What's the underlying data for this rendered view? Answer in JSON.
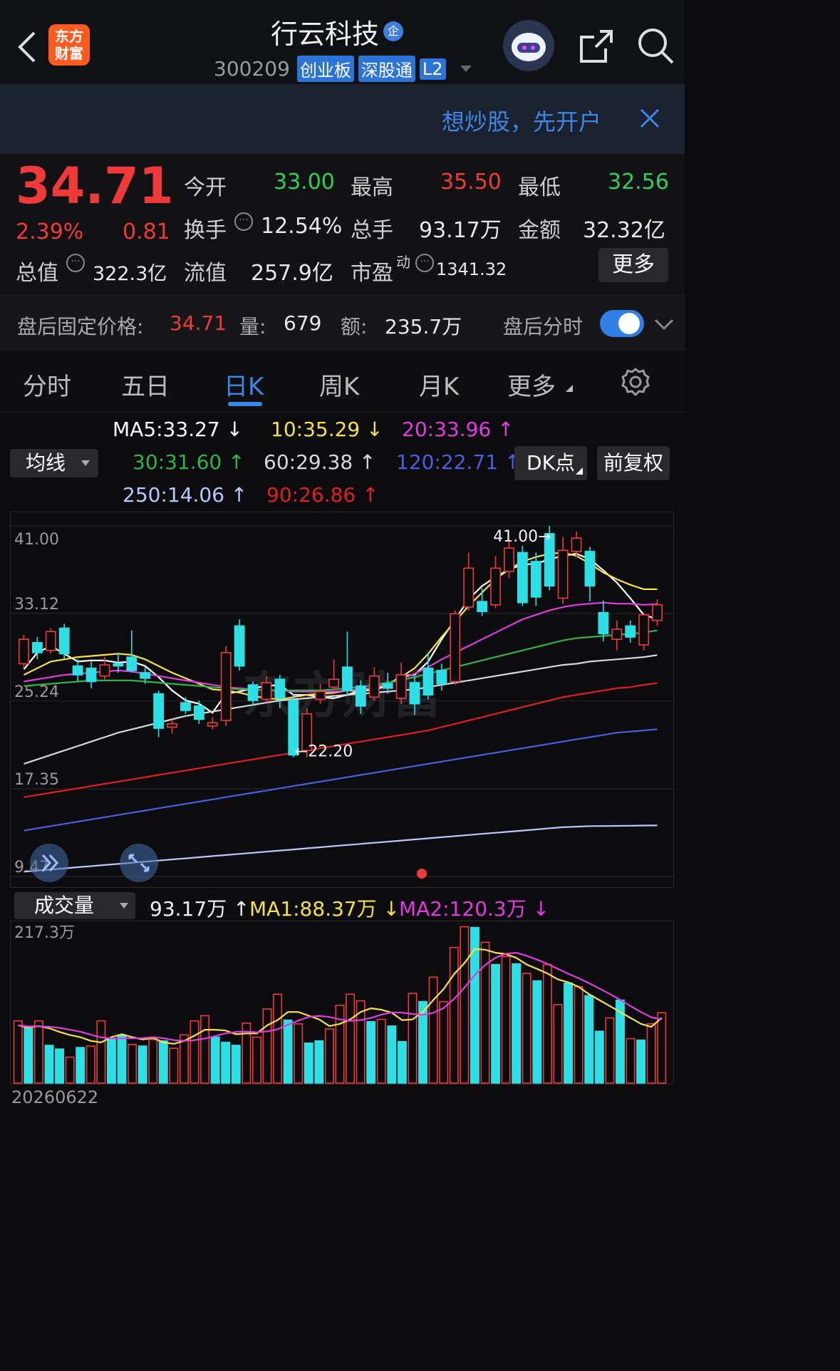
{
  "header": {
    "stock_name": "行云科技",
    "badge": "企",
    "code": "300209",
    "tags": [
      "创业板",
      "深股通",
      "L2"
    ],
    "logo_text": "东方财富"
  },
  "banner": {
    "text": "想炒股，先开户"
  },
  "quote": {
    "price": "34.71",
    "change_pct": "2.39%",
    "change": "0.81",
    "fields": [
      {
        "label": "今开",
        "value": "33.00",
        "color": "#2fd05a"
      },
      {
        "label": "最高",
        "value": "35.50",
        "color": "#f03a3a"
      },
      {
        "label": "最低",
        "value": "32.56",
        "color": "#2fd05a"
      },
      {
        "label": "换手",
        "value": "12.54%",
        "color": "#e8e8e8"
      },
      {
        "label": "总手",
        "value": "93.17万",
        "color": "#e8e8e8"
      },
      {
        "label": "金额",
        "value": "32.32亿",
        "color": "#e8e8e8"
      },
      {
        "label": "总值",
        "value": "322.3亿",
        "color": "#e8e8e8"
      },
      {
        "label": "流值",
        "value": "257.9亿",
        "color": "#e8e8e8"
      },
      {
        "label": "市盈",
        "sup": "动",
        "value": "1341.32",
        "color": "#e8e8e8"
      }
    ],
    "more_button": "更多"
  },
  "after_hours": {
    "label": "盘后固定价格:",
    "price": "34.71",
    "vol_label": "量:",
    "vol": "679",
    "amt_label": "额:",
    "amt": "235.7万",
    "toggle_label": "盘后分时",
    "toggle_on": true
  },
  "tabs": [
    "分时",
    "五日",
    "日K",
    "周K",
    "月K",
    "更多"
  ],
  "active_tab": "日K",
  "ma_legend": [
    {
      "text": "MA5:33.27 ↓",
      "color": "#ffffff"
    },
    {
      "text": "10:35.29 ↓",
      "color": "#f5e24a"
    },
    {
      "text": "20:33.96 ↑",
      "color": "#e03ce0"
    },
    {
      "text": "30:31.60 ↑",
      "color": "#2fb34a"
    },
    {
      "text": "60:29.38 ↑",
      "color": "#d8d8d8"
    },
    {
      "text": "120:22.71 ↑",
      "color": "#4a5ee0"
    },
    {
      "text": "250:14.06 ↑",
      "color": "#b9c7ff"
    },
    {
      "text": "90:26.86 ↑",
      "color": "#e02020"
    }
  ],
  "controls": {
    "ma_select": "均线",
    "dk_button": "DK点",
    "fq_button": "前复权"
  },
  "volume_legend": {
    "select": "成交量",
    "vol": "93.17万 ↑",
    "ma1": "MA1:88.37万 ↓",
    "ma2": "MA2:120.3万 ↓",
    "ma1_color": "#f5e24a",
    "ma2_color": "#e03ce0"
  },
  "colors": {
    "up": "#f03a3a",
    "down": "#2ce0e6",
    "accent": "#3e86e6"
  },
  "watermark": "东方财富",
  "chart_data": {
    "type": "candlestick",
    "date_label": "20260622",
    "y_ticks": [
      "41.00",
      "33.12",
      "25.24",
      "17.35",
      "9.47"
    ],
    "ylim": [
      9.47,
      41.0
    ],
    "annotations": [
      {
        "text": "41.00",
        "value": 41.0,
        "index": 40
      },
      {
        "text": "22.20",
        "value": 22.2,
        "index": 20
      }
    ],
    "candles": [
      {
        "o": 28.6,
        "c": 30.8,
        "h": 31.2,
        "l": 28.2
      },
      {
        "o": 30.5,
        "c": 29.6,
        "h": 31.0,
        "l": 29.0
      },
      {
        "o": 29.8,
        "c": 31.5,
        "h": 31.8,
        "l": 29.5
      },
      {
        "o": 31.8,
        "c": 29.5,
        "h": 32.2,
        "l": 29.0
      },
      {
        "o": 28.4,
        "c": 27.6,
        "h": 29.0,
        "l": 27.0
      },
      {
        "o": 28.2,
        "c": 27.0,
        "h": 28.8,
        "l": 26.4
      },
      {
        "o": 27.5,
        "c": 28.5,
        "h": 29.2,
        "l": 27.2
      },
      {
        "o": 28.6,
        "c": 28.4,
        "h": 29.6,
        "l": 27.8
      },
      {
        "o": 29.2,
        "c": 28.0,
        "h": 31.6,
        "l": 27.8
      },
      {
        "o": 27.8,
        "c": 27.3,
        "h": 28.3,
        "l": 26.8
      },
      {
        "o": 25.9,
        "c": 22.8,
        "h": 26.2,
        "l": 22.0
      },
      {
        "o": 22.9,
        "c": 23.2,
        "h": 23.6,
        "l": 22.3
      },
      {
        "o": 25.1,
        "c": 24.4,
        "h": 25.6,
        "l": 24.1
      },
      {
        "o": 24.8,
        "c": 23.6,
        "h": 25.3,
        "l": 23.2
      },
      {
        "o": 23.0,
        "c": 23.3,
        "h": 23.8,
        "l": 22.7
      },
      {
        "o": 23.5,
        "c": 29.6,
        "h": 30.2,
        "l": 23.0
      },
      {
        "o": 32.0,
        "c": 28.4,
        "h": 32.6,
        "l": 28.0
      },
      {
        "o": 26.7,
        "c": 25.3,
        "h": 27.0,
        "l": 24.8
      },
      {
        "o": 25.4,
        "c": 26.9,
        "h": 27.5,
        "l": 25.1
      },
      {
        "o": 27.2,
        "c": 25.5,
        "h": 27.6,
        "l": 24.6
      },
      {
        "o": 25.3,
        "c": 20.4,
        "h": 25.8,
        "l": 20.2
      },
      {
        "o": 20.8,
        "c": 24.1,
        "h": 24.6,
        "l": 20.2
      },
      {
        "o": 25.4,
        "c": 26.1,
        "h": 26.8,
        "l": 25.0
      },
      {
        "o": 26.5,
        "c": 27.2,
        "h": 29.0,
        "l": 26.2
      },
      {
        "o": 28.3,
        "c": 26.2,
        "h": 31.5,
        "l": 25.8
      },
      {
        "o": 26.6,
        "c": 24.8,
        "h": 27.1,
        "l": 24.1
      },
      {
        "o": 25.6,
        "c": 27.5,
        "h": 28.3,
        "l": 25.3
      },
      {
        "o": 26.8,
        "c": 26.4,
        "h": 27.8,
        "l": 25.9
      },
      {
        "o": 25.5,
        "c": 27.6,
        "h": 28.7,
        "l": 25.0
      },
      {
        "o": 26.9,
        "c": 25.0,
        "h": 27.4,
        "l": 24.0
      },
      {
        "o": 28.2,
        "c": 25.8,
        "h": 29.6,
        "l": 25.4
      },
      {
        "o": 28.0,
        "c": 26.8,
        "h": 28.6,
        "l": 26.2
      },
      {
        "o": 27.0,
        "c": 33.1,
        "h": 33.4,
        "l": 26.7
      },
      {
        "o": 33.7,
        "c": 37.2,
        "h": 38.6,
        "l": 33.4
      },
      {
        "o": 34.2,
        "c": 33.3,
        "h": 35.4,
        "l": 32.9
      },
      {
        "o": 33.9,
        "c": 37.2,
        "h": 38.3,
        "l": 33.6
      },
      {
        "o": 36.9,
        "c": 39.0,
        "h": 39.6,
        "l": 36.3
      },
      {
        "o": 38.6,
        "c": 34.1,
        "h": 39.2,
        "l": 33.8
      },
      {
        "o": 37.8,
        "c": 34.6,
        "h": 38.6,
        "l": 33.8
      },
      {
        "o": 40.3,
        "c": 35.6,
        "h": 41.0,
        "l": 35.2
      },
      {
        "o": 34.5,
        "c": 38.8,
        "h": 40.0,
        "l": 34.0
      },
      {
        "o": 38.7,
        "c": 39.9,
        "h": 40.5,
        "l": 38.2
      },
      {
        "o": 38.7,
        "c": 35.6,
        "h": 39.1,
        "l": 34.2
      },
      {
        "o": 33.2,
        "c": 31.3,
        "h": 34.3,
        "l": 30.6
      },
      {
        "o": 30.8,
        "c": 31.7,
        "h": 32.5,
        "l": 29.8
      },
      {
        "o": 32.0,
        "c": 31.0,
        "h": 32.5,
        "l": 30.5
      },
      {
        "o": 30.3,
        "c": 33.0,
        "h": 33.2,
        "l": 29.8
      },
      {
        "o": 32.5,
        "c": 33.9,
        "h": 34.4,
        "l": 32.0
      }
    ],
    "ma_lines": [
      {
        "name": "MA5",
        "color": "#ffffff",
        "values": [
          28.1,
          29.6,
          30.2,
          29.5,
          28.8,
          28.9,
          28.9,
          28.7,
          28.8,
          28.4,
          27.4,
          26.2,
          25.3,
          25.0,
          24.2,
          25.9,
          26.1,
          26.4,
          26.6,
          26.7,
          25.8,
          25.8,
          25.6,
          25.5,
          25.8,
          26.2,
          26.2,
          26.7,
          27.5,
          27.6,
          28.8,
          30.8,
          32.6,
          34.4,
          35.6,
          36.4,
          37.1,
          37.5,
          37.6,
          38.0,
          38.3,
          38.5,
          38.0,
          37.0,
          35.9,
          34.5,
          33.0,
          32.6
        ]
      },
      {
        "name": "MA10",
        "color": "#f5e24a",
        "values": [
          27.6,
          28.2,
          28.8,
          29.0,
          29.2,
          29.3,
          29.4,
          29.5,
          29.4,
          29.0,
          28.4,
          27.8,
          27.3,
          26.8,
          26.3,
          26.2,
          26.0,
          25.7,
          25.5,
          25.4,
          25.6,
          25.8,
          25.9,
          26.0,
          26.2,
          26.1,
          26.4,
          26.8,
          27.4,
          28.2,
          29.5,
          31.0,
          32.4,
          33.8,
          35.0,
          36.2,
          37.1,
          37.8,
          38.2,
          38.5,
          38.6,
          38.3,
          37.6,
          36.8,
          36.2,
          35.7,
          35.3,
          35.3
        ]
      },
      {
        "name": "MA20",
        "color": "#e03ce0",
        "values": [
          27.0,
          27.2,
          27.4,
          27.6,
          27.7,
          27.8,
          27.9,
          28.0,
          27.9,
          27.7,
          27.5,
          27.3,
          27.1,
          26.9,
          26.7,
          26.5,
          26.4,
          26.3,
          26.2,
          26.2,
          26.1,
          26.1,
          26.1,
          26.1,
          26.2,
          26.3,
          26.5,
          26.8,
          27.2,
          27.7,
          28.3,
          29.0,
          29.6,
          30.2,
          30.8,
          31.4,
          32.0,
          32.6,
          33.0,
          33.4,
          33.7,
          33.9,
          34.0,
          34.1,
          34.0,
          34.0,
          33.9,
          33.96
        ]
      },
      {
        "name": "MA30",
        "color": "#2fb34a",
        "values": [
          26.6,
          26.7,
          26.8,
          26.9,
          27.0,
          27.1,
          27.1,
          27.1,
          27.1,
          27.0,
          26.9,
          26.8,
          26.7,
          26.6,
          26.5,
          26.4,
          26.3,
          26.3,
          26.2,
          26.2,
          26.2,
          26.2,
          26.2,
          26.3,
          26.4,
          26.5,
          26.7,
          26.9,
          27.1,
          27.4,
          27.7,
          28.0,
          28.3,
          28.6,
          28.9,
          29.2,
          29.5,
          29.8,
          30.1,
          30.4,
          30.7,
          30.9,
          31.0,
          31.1,
          31.2,
          31.3,
          31.4,
          31.6
        ]
      },
      {
        "name": "MA60",
        "color": "#d8d8d8",
        "values": [
          19.6,
          20.0,
          20.4,
          20.8,
          21.2,
          21.6,
          22.0,
          22.4,
          22.7,
          23.0,
          23.3,
          23.6,
          23.9,
          24.1,
          24.3,
          24.5,
          24.7,
          24.9,
          25.1,
          25.3,
          25.4,
          25.5,
          25.6,
          25.7,
          25.8,
          25.9,
          26.0,
          26.1,
          26.2,
          26.3,
          26.5,
          26.7,
          26.9,
          27.1,
          27.3,
          27.5,
          27.7,
          27.9,
          28.1,
          28.3,
          28.5,
          28.6,
          28.8,
          28.9,
          29.0,
          29.1,
          29.2,
          29.38
        ]
      },
      {
        "name": "MA90",
        "color": "#e02020",
        "values": [
          16.6,
          16.8,
          17.0,
          17.2,
          17.4,
          17.6,
          17.8,
          18.0,
          18.2,
          18.4,
          18.6,
          18.8,
          19.0,
          19.2,
          19.4,
          19.6,
          19.8,
          20.0,
          20.2,
          20.4,
          20.6,
          20.8,
          21.0,
          21.2,
          21.4,
          21.6,
          21.8,
          22.0,
          22.2,
          22.4,
          22.6,
          22.9,
          23.2,
          23.5,
          23.8,
          24.1,
          24.4,
          24.7,
          25.0,
          25.3,
          25.6,
          25.8,
          26.0,
          26.2,
          26.4,
          26.5,
          26.7,
          26.86
        ]
      },
      {
        "name": "MA120",
        "color": "#4a5ee0",
        "values": [
          13.6,
          13.8,
          14.0,
          14.2,
          14.4,
          14.6,
          14.8,
          15.0,
          15.2,
          15.4,
          15.6,
          15.8,
          16.0,
          16.2,
          16.4,
          16.6,
          16.8,
          17.0,
          17.2,
          17.4,
          17.6,
          17.8,
          18.0,
          18.2,
          18.4,
          18.6,
          18.8,
          19.0,
          19.2,
          19.4,
          19.6,
          19.8,
          20.0,
          20.2,
          20.4,
          20.6,
          20.8,
          21.0,
          21.2,
          21.4,
          21.6,
          21.8,
          22.0,
          22.2,
          22.4,
          22.5,
          22.6,
          22.71
        ]
      },
      {
        "name": "MA250",
        "color": "#b9c7ff",
        "values": [
          9.9,
          10.0,
          10.1,
          10.2,
          10.3,
          10.4,
          10.5,
          10.6,
          10.7,
          10.8,
          10.9,
          11.0,
          11.1,
          11.2,
          11.3,
          11.4,
          11.5,
          11.6,
          11.7,
          11.8,
          11.9,
          12.0,
          12.1,
          12.2,
          12.3,
          12.4,
          12.5,
          12.6,
          12.7,
          12.8,
          12.9,
          13.0,
          13.1,
          13.2,
          13.3,
          13.4,
          13.5,
          13.6,
          13.7,
          13.8,
          13.9,
          13.95,
          14.0,
          14.01,
          14.02,
          14.03,
          14.05,
          14.06
        ]
      }
    ],
    "volume": {
      "max_label": "217.3万",
      "ymax": 217.3,
      "bars": [
        84,
        76,
        84,
        51,
        46,
        35,
        48,
        50,
        84,
        60,
        65,
        52,
        50,
        59,
        57,
        47,
        65,
        84,
        91,
        62,
        55,
        51,
        81,
        62,
        100,
        120,
        85,
        80,
        54,
        57,
        73,
        105,
        120,
        111,
        83,
        86,
        77,
        56,
        121,
        110,
        143,
        110,
        183,
        211,
        210,
        190,
        160,
        171,
        161,
        148,
        138,
        160,
        106,
        135,
        130,
        118,
        70,
        88,
        112,
        60,
        58,
        80,
        95
      ],
      "up": [
        1,
        0,
        1,
        0,
        0,
        1,
        0,
        1,
        1,
        0,
        0,
        1,
        0,
        1,
        0,
        1,
        1,
        1,
        1,
        0,
        0,
        0,
        1,
        1,
        1,
        1,
        0,
        1,
        0,
        0,
        1,
        1,
        1,
        1,
        0,
        1,
        0,
        0,
        1,
        0,
        1,
        1,
        1,
        1,
        0,
        1,
        0,
        1,
        0,
        1,
        0,
        1,
        1,
        0,
        1,
        0,
        0,
        1,
        0,
        1,
        0,
        1,
        1
      ],
      "ma1": [
        78,
        75,
        77,
        74,
        69,
        65,
        62,
        57,
        55,
        62,
        66,
        62,
        59,
        61,
        55,
        53,
        57,
        64,
        72,
        72,
        71,
        66,
        67,
        67,
        78,
        85,
        96,
        96,
        91,
        86,
        77,
        80,
        86,
        96,
        101,
        99,
        95,
        85,
        86,
        96,
        112,
        127,
        147,
        162,
        181,
        180,
        176,
        174,
        169,
        160,
        154,
        148,
        140,
        136,
        130,
        120,
        112,
        104,
        96,
        88,
        80,
        76,
        88
      ]
    }
  }
}
